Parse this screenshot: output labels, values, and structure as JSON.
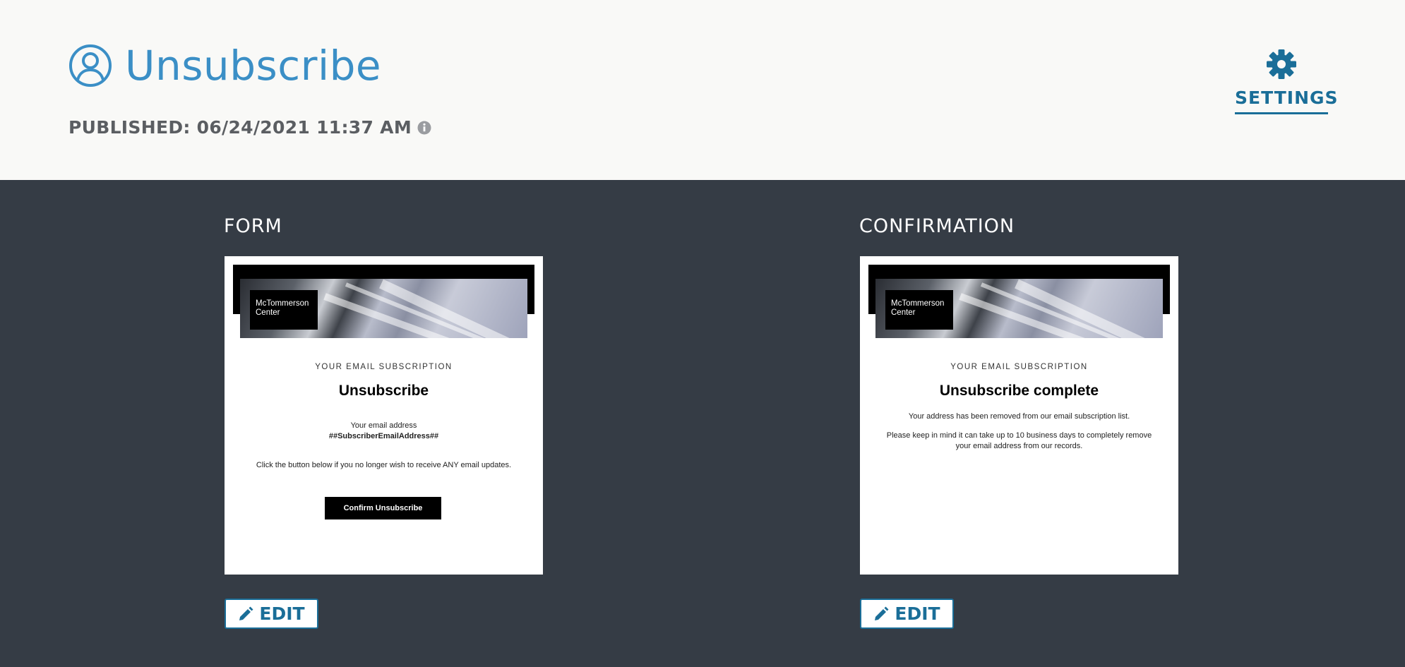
{
  "header": {
    "title": "Unsubscribe",
    "published_label": "PUBLISHED: 06/24/2021 11:37 AM",
    "settings_label": "SETTINGS"
  },
  "panels": [
    {
      "heading": "FORM",
      "preview": {
        "logo_line1": "McTommerson",
        "logo_line2": "Center",
        "kicker": "YOUR EMAIL SUBSCRIPTION",
        "title": "Unsubscribe",
        "line1": "Your email address",
        "line2": "##SubscriberEmailAddress##",
        "line3": "Click the button below if you no longer wish to receive ANY email updates.",
        "button": "Confirm Unsubscribe"
      },
      "edit_label": "EDIT"
    },
    {
      "heading": "CONFIRMATION",
      "preview": {
        "logo_line1": "McTommerson",
        "logo_line2": "Center",
        "kicker": "YOUR EMAIL SUBSCRIPTION",
        "title": "Unsubscribe complete",
        "line1": "Your address has been removed from our email subscription list.",
        "line2": "Please keep in mind it can take up to 10 business days to completely remove",
        "line3": "your email address from our records."
      },
      "edit_label": "EDIT"
    }
  ],
  "colors": {
    "header_bg": "#f9f9f7",
    "body_bg": "#353c45",
    "title_blue": "#3b8fc6",
    "accent": "#1a6e98"
  },
  "icons": [
    "user-circle-icon",
    "info-icon",
    "gear-icon",
    "pencil-icon"
  ]
}
